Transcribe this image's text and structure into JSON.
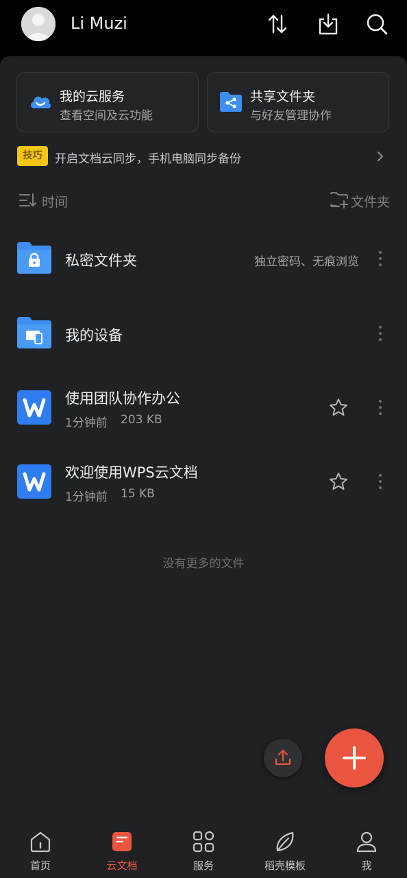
{
  "header": {
    "username": "Li Muzi"
  },
  "cards": [
    {
      "title": "我的云服务",
      "subtitle": "查看空间及云功能",
      "icon": "cloud-icon"
    },
    {
      "title": "共享文件夹",
      "subtitle": "与好友管理协作",
      "icon": "shared-folder-icon"
    }
  ],
  "tip": {
    "badge": "技巧",
    "text": "开启文档云同步，手机电脑同步备份"
  },
  "sort": {
    "label": "时间",
    "folder_label": "文件夹"
  },
  "items": [
    {
      "name": "私密文件夹",
      "hint": "独立密码、无痕浏览",
      "icon": "private-folder-icon"
    },
    {
      "name": "我的设备",
      "icon": "device-folder-icon"
    },
    {
      "name": "使用团队协作办公",
      "time": "1分钟前",
      "size": "203 KB",
      "icon": "wps-writer-icon"
    },
    {
      "name": "欢迎使用WPS云文档",
      "time": "1分钟前",
      "size": "15 KB",
      "icon": "wps-writer-icon"
    }
  ],
  "no_more": "没有更多的文件",
  "nav": [
    {
      "label": "首页",
      "icon": "home-icon"
    },
    {
      "label": "云文档",
      "icon": "cloud-doc-icon",
      "active": true
    },
    {
      "label": "服务",
      "icon": "apps-grid-icon"
    },
    {
      "label": "稻壳模板",
      "icon": "leaf-icon"
    },
    {
      "label": "我",
      "icon": "profile-icon"
    }
  ],
  "colors": {
    "accent": "#e9553f",
    "background": "#202124",
    "tip_badge": "#f5c518",
    "folder_blue": "#3d8ef0"
  }
}
